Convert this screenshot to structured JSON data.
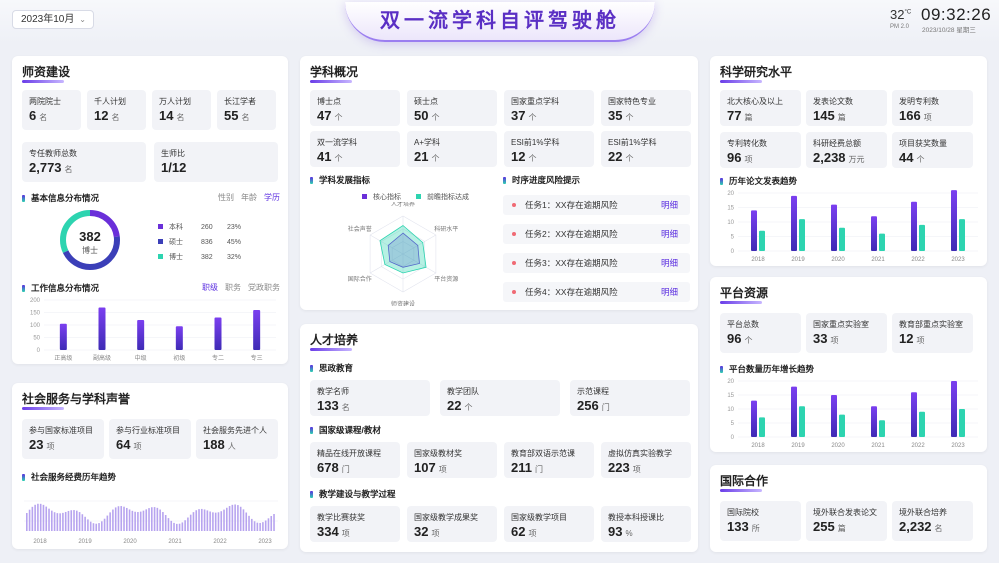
{
  "header": {
    "date_select": "2023年10月",
    "title": "双一流学科自评驾驶舱",
    "temperature": "32",
    "temp_unit": "°C",
    "weather_sub": "PM 2.0",
    "time": "09:32:26",
    "date": "2023/10/28 星期三"
  },
  "colors": {
    "accent": "#5b2ee0",
    "teal": "#2dd4b0",
    "purple_bar": "#6a2fd9",
    "risk_dot": "#f06a74"
  },
  "faculty": {
    "title": "师资建设",
    "stats": [
      {
        "label": "两院院士",
        "value": "6",
        "unit": "名"
      },
      {
        "label": "千人计划",
        "value": "12",
        "unit": "名"
      },
      {
        "label": "万人计划",
        "value": "14",
        "unit": "名"
      },
      {
        "label": "长江学者",
        "value": "55",
        "unit": "名"
      },
      {
        "label": "专任教师总数",
        "value": "2,773",
        "unit": "名"
      },
      {
        "label": "生师比",
        "value": "1/12",
        "unit": ""
      }
    ],
    "basic_title": "基本信息分布情况",
    "basic_tabs": [
      "性别",
      "年龄",
      "学历"
    ],
    "donut": {
      "value": "382",
      "label": "博士"
    },
    "legend": [
      {
        "name": "本科",
        "count": "260",
        "pct": "23%",
        "color": "#6a2fd9"
      },
      {
        "name": "硕士",
        "count": "836",
        "pct": "45%",
        "color": "#3b3fb8"
      },
      {
        "name": "博士",
        "count": "382",
        "pct": "32%",
        "color": "#2dd4b0"
      }
    ],
    "work_title": "工作信息分布情况",
    "work_tabs": [
      "职级",
      "职务",
      "党政职务"
    ]
  },
  "work_chart": {
    "chart_data": {
      "type": "bar",
      "categories": [
        "正高级",
        "副高级",
        "中级",
        "初级",
        "专二",
        "专三"
      ],
      "values": [
        105,
        170,
        120,
        95,
        130,
        160
      ],
      "ylim": [
        0,
        200
      ],
      "yticks": [
        "0",
        "50",
        "100",
        "150",
        "200"
      ]
    }
  },
  "social": {
    "title": "社会服务与学科声誉",
    "stats": [
      {
        "label": "参与国家标准项目",
        "value": "23",
        "unit": "项"
      },
      {
        "label": "参与行业标准项目",
        "value": "64",
        "unit": "项"
      },
      {
        "label": "社会服务先进个人",
        "value": "188",
        "unit": "人"
      }
    ],
    "trend_title": "社会服务经费历年趋势",
    "years": [
      "2018",
      "2019",
      "2020",
      "2021",
      "2022",
      "2023"
    ]
  },
  "discipline": {
    "title": "学科概况",
    "stats": [
      {
        "label": "博士点",
        "value": "47",
        "unit": "个"
      },
      {
        "label": "硕士点",
        "value": "50",
        "unit": "个"
      },
      {
        "label": "国家重点学科",
        "value": "37",
        "unit": "个"
      },
      {
        "label": "国家特色专业",
        "value": "35",
        "unit": "个"
      },
      {
        "label": "双一流学科",
        "value": "41",
        "unit": "个"
      },
      {
        "label": "A+学科",
        "value": "21",
        "unit": "个"
      },
      {
        "label": "ESI前1%学科",
        "value": "12",
        "unit": "个"
      },
      {
        "label": "ESI前1%学科",
        "value": "22",
        "unit": "个"
      }
    ],
    "dev_title": "学科发展指标",
    "radar_legend": [
      "核心指标",
      "前瞻指标达成"
    ],
    "radar_axes": [
      "人才培养",
      "科研水平",
      "平台资源",
      "师资建设",
      "国际合作",
      "社会声誉"
    ],
    "risk_title": "时序进度风险提示",
    "risks": [
      {
        "text": "任务1：XX存在逾期风险",
        "link": "明细"
      },
      {
        "text": "任务2：XX存在逾期风险",
        "link": "明细"
      },
      {
        "text": "任务3：XX存在逾期风险",
        "link": "明细"
      },
      {
        "text": "任务4：XX存在逾期风险",
        "link": "明细"
      }
    ]
  },
  "radar_chart": {
    "chart_data": {
      "type": "radar",
      "axes": [
        "人才培养",
        "科研水平",
        "平台资源",
        "师资建设",
        "国际合作",
        "社会声誉"
      ],
      "series": [
        {
          "name": "核心指标",
          "values": [
            0.55,
            0.45,
            0.5,
            0.35,
            0.4,
            0.45
          ]
        },
        {
          "name": "前瞻指标达成",
          "values": [
            0.75,
            0.6,
            0.7,
            0.5,
            0.55,
            0.7
          ]
        }
      ]
    }
  },
  "talent": {
    "title": "人才培养",
    "ideology_title": "思政教育",
    "ideology": [
      {
        "label": "教学名师",
        "value": "133",
        "unit": "名"
      },
      {
        "label": "教学团队",
        "value": "22",
        "unit": "个"
      },
      {
        "label": "示范课程",
        "value": "256",
        "unit": "门"
      }
    ],
    "course_title": "国家级课程/教材",
    "courses": [
      {
        "label": "精品在线开放课程",
        "value": "678",
        "unit": "门"
      },
      {
        "label": "国家级教材奖",
        "value": "107",
        "unit": "项"
      },
      {
        "label": "教育部双语示范课",
        "value": "211",
        "unit": "门"
      },
      {
        "label": "虚拟仿真实验教学",
        "value": "223",
        "unit": "项"
      }
    ],
    "reform_title": "教学建设与教学过程",
    "reform": [
      {
        "label": "教学比赛获奖",
        "value": "334",
        "unit": "项"
      },
      {
        "label": "国家级教学成果奖",
        "value": "32",
        "unit": "项"
      },
      {
        "label": "国家级教学项目",
        "value": "62",
        "unit": "项"
      },
      {
        "label": "教授本科授课比",
        "value": "93",
        "unit": "%"
      }
    ]
  },
  "research": {
    "title": "科学研究水平",
    "stats": [
      {
        "label": "北大核心及以上",
        "value": "77",
        "unit": "篇"
      },
      {
        "label": "发表论文数",
        "value": "145",
        "unit": "篇"
      },
      {
        "label": "发明专利数",
        "value": "166",
        "unit": "项"
      },
      {
        "label": "专利转化数",
        "value": "96",
        "unit": "项"
      },
      {
        "label": "科研经费总额",
        "value": "2,238",
        "unit": "万元"
      },
      {
        "label": "项目获奖数量",
        "value": "44",
        "unit": "个"
      }
    ],
    "trend_title": "历年论文发表趋势"
  },
  "paper_chart": {
    "chart_data": {
      "type": "bar",
      "categories": [
        "2018",
        "2019",
        "2020",
        "2021",
        "2022",
        "2023"
      ],
      "series": [
        {
          "values": [
            14,
            19,
            16,
            12,
            17,
            21
          ]
        },
        {
          "values": [
            7,
            11,
            8,
            6,
            9,
            11
          ]
        }
      ],
      "ylim": [
        0,
        20
      ],
      "yticks": [
        "0",
        "5",
        "10",
        "15",
        "20"
      ]
    }
  },
  "platform": {
    "title": "平台资源",
    "stats": [
      {
        "label": "平台总数",
        "value": "96",
        "unit": "个"
      },
      {
        "label": "国家重点实验室",
        "value": "33",
        "unit": "项"
      },
      {
        "label": "教育部重点实验室",
        "value": "12",
        "unit": "项"
      }
    ],
    "trend_title": "平台数量历年增长趋势"
  },
  "platform_chart": {
    "chart_data": {
      "type": "bar",
      "categories": [
        "2018",
        "2019",
        "2020",
        "2021",
        "2022",
        "2023"
      ],
      "series": [
        {
          "values": [
            13,
            18,
            15,
            11,
            16,
            20
          ]
        },
        {
          "values": [
            7,
            11,
            8,
            6,
            9,
            10
          ]
        }
      ],
      "ylim": [
        0,
        20
      ],
      "yticks": [
        "0",
        "5",
        "10",
        "15",
        "20"
      ]
    }
  },
  "international": {
    "title": "国际合作",
    "stats": [
      {
        "label": "国际院校",
        "value": "133",
        "unit": "所"
      },
      {
        "label": "境外联合发表论文",
        "value": "255",
        "unit": "篇"
      },
      {
        "label": "境外联合培养",
        "value": "2,232",
        "unit": "名"
      }
    ]
  }
}
